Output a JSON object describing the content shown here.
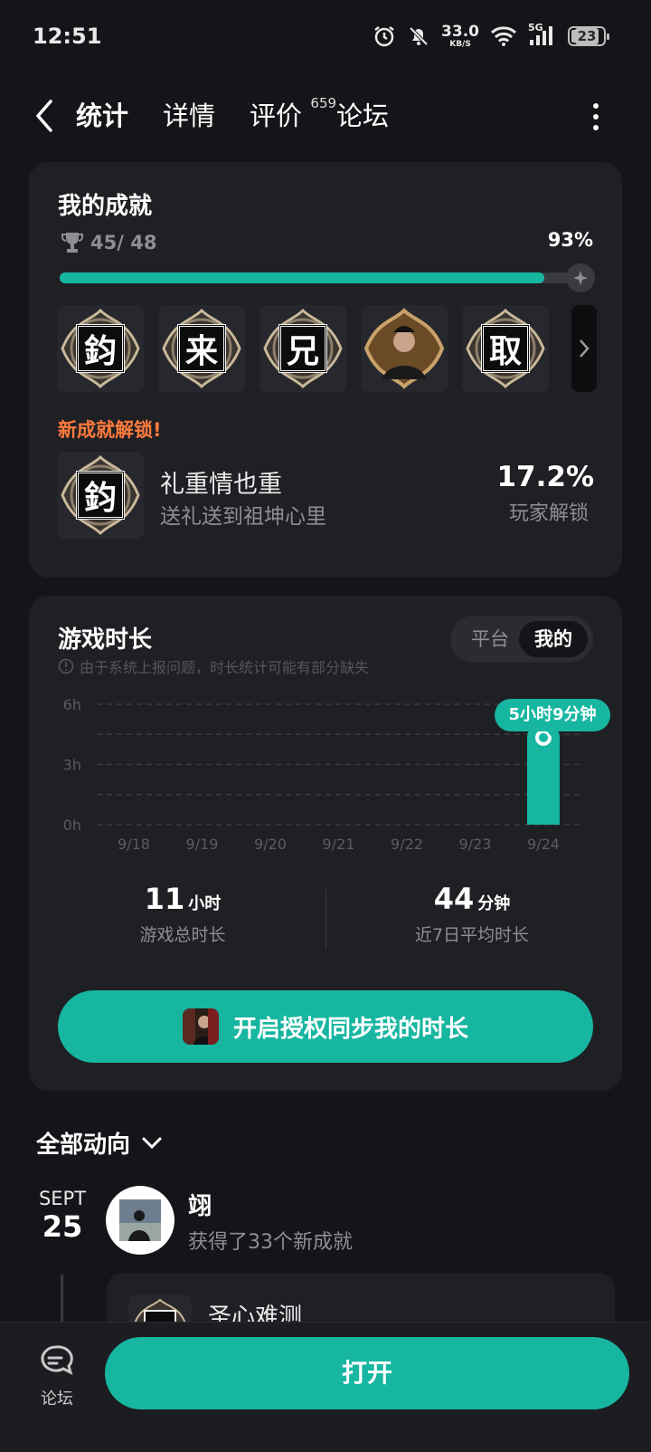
{
  "status_bar": {
    "time": "12:51",
    "net_speed_value": "33.0",
    "net_speed_unit": "KB/S",
    "network_type": "5G",
    "battery": "23"
  },
  "nav": {
    "tabs": [
      {
        "label": "统计",
        "active": true
      },
      {
        "label": "详情",
        "active": false
      },
      {
        "label": "评价",
        "active": false,
        "badge": "659"
      },
      {
        "label": "论坛",
        "active": false
      }
    ]
  },
  "achievements": {
    "title": "我的成就",
    "count": "45/ 48",
    "percent": "93%",
    "progress": 0.93,
    "badges": [
      {
        "glyph": "鈞",
        "type": "glyph"
      },
      {
        "glyph": "来",
        "type": "glyph"
      },
      {
        "glyph": "兄",
        "type": "glyph"
      },
      {
        "glyph": "",
        "type": "portrait"
      },
      {
        "glyph": "取",
        "type": "glyph"
      }
    ],
    "new_unlock_label": "新成就解锁!",
    "new_unlock": {
      "glyph": "鈞",
      "name": "礼重情也重",
      "description": "送礼送到祖坤心里",
      "percent": "17.2%",
      "percent_label": "玩家解锁"
    }
  },
  "playtime": {
    "title": "游戏时长",
    "note": "由于系统上报问题，时长统计可能有部分缺失",
    "toggle": {
      "left": "平台",
      "right": "我的",
      "selected": "我的"
    },
    "callout": "5小时9分钟",
    "total_value": "11",
    "total_unit": "小时",
    "total_label": "游戏总时长",
    "avg_value": "44",
    "avg_unit": "分钟",
    "avg_label": "近7日平均时长",
    "sync_button": "开启授权同步我的时长"
  },
  "chart_data": {
    "type": "bar",
    "categories": [
      "9/18",
      "9/19",
      "9/20",
      "9/21",
      "9/22",
      "9/23",
      "9/24"
    ],
    "values": [
      0,
      0,
      0,
      0,
      0,
      0,
      5.15
    ],
    "ylabel": "",
    "y_ticks": [
      "0h",
      "3h",
      "6h"
    ],
    "ylim": [
      0,
      6
    ],
    "grid": true,
    "bar_color": "#17b6a1",
    "highlight_label": "5小时9分钟"
  },
  "feed": {
    "header": "全部动向",
    "date_month": "SEPT",
    "date_day": "25",
    "user": "翊",
    "description": "获得了33个新成就",
    "item_name": "圣心难测"
  },
  "bottom_bar": {
    "forum_label": "论坛",
    "open_label": "打开"
  },
  "colors": {
    "accent": "#17b6a1",
    "highlight": "#ff7a3d",
    "background": "#141518",
    "card": "#1f2024"
  }
}
